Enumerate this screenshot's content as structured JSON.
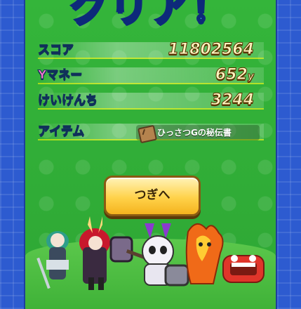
{
  "title": "クリア！",
  "results": {
    "score": {
      "label": "スコア",
      "value": "11802564"
    },
    "money": {
      "label": "Yマネー",
      "value": "652",
      "unit": "y"
    },
    "exp": {
      "label": "けいけんち",
      "value": "3244"
    },
    "item": {
      "label": "アイテム",
      "value": "ひっさつGの秘伝書"
    }
  },
  "buttons": {
    "next": "つぎへ"
  },
  "colors": {
    "panel": "#34b53a",
    "border": "#2d5bd0",
    "button": "#ffd24a"
  }
}
